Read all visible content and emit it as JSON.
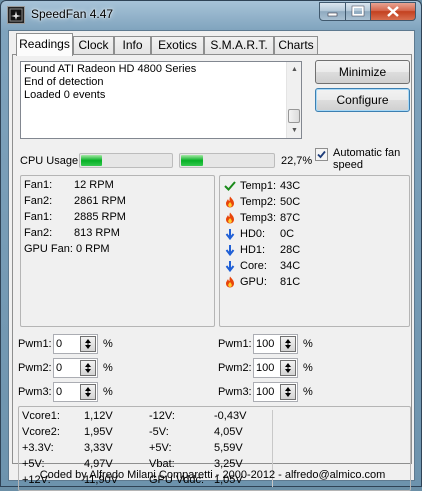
{
  "window": {
    "title": "SpeedFan 4.47",
    "controls": {
      "minimize": "minimize-glyph",
      "maximize": "maximize-glyph",
      "close": "close-glyph"
    }
  },
  "tabs": [
    {
      "label": "Readings",
      "active": true
    },
    {
      "label": "Clock"
    },
    {
      "label": "Info"
    },
    {
      "label": "Exotics"
    },
    {
      "label": "S.M.A.R.T."
    },
    {
      "label": "Charts"
    }
  ],
  "log": {
    "lines": [
      "Found ATI Radeon HD 4800 Series",
      "End of detection",
      "Loaded 0 events"
    ]
  },
  "buttons": {
    "minimize": "Minimize",
    "configure": "Configure"
  },
  "auto_fan": {
    "label": "Automatic fan speed",
    "checked": true
  },
  "cpu": {
    "label": "CPU Usage",
    "value": "22,7%",
    "bar1_fraction": 0.23,
    "bar2_fraction": 0.23,
    "bar_color": "#06b025"
  },
  "fans": [
    {
      "name": "Fan1:",
      "value": "12 RPM"
    },
    {
      "name": "Fan2:",
      "value": "2861 RPM"
    },
    {
      "name": "Fan1:",
      "value": "2885 RPM"
    },
    {
      "name": "Fan2:",
      "value": "813 RPM"
    },
    {
      "name": "GPU Fan:",
      "value": "0 RPM"
    }
  ],
  "temps": [
    {
      "icon": "check-icon",
      "name": "Temp1:",
      "value": "43C"
    },
    {
      "icon": "flame-icon",
      "name": "Temp2:",
      "value": "50C"
    },
    {
      "icon": "flame-icon",
      "name": "Temp3:",
      "value": "87C"
    },
    {
      "icon": "down-arrow-icon",
      "name": "HD0:",
      "value": "0C"
    },
    {
      "icon": "down-arrow-icon",
      "name": "HD1:",
      "value": "28C"
    },
    {
      "icon": "down-arrow-icon",
      "name": "Core:",
      "value": "34C"
    },
    {
      "icon": "flame-icon",
      "name": "GPU:",
      "value": "81C"
    }
  ],
  "pwm_left": [
    {
      "label": "Pwm1:",
      "value": "0",
      "unit": "%"
    },
    {
      "label": "Pwm2:",
      "value": "0",
      "unit": "%"
    },
    {
      "label": "Pwm3:",
      "value": "0",
      "unit": "%"
    }
  ],
  "pwm_right": [
    {
      "label": "Pwm1:",
      "value": "100",
      "unit": "%"
    },
    {
      "label": "Pwm2:",
      "value": "100",
      "unit": "%"
    },
    {
      "label": "Pwm3:",
      "value": "100",
      "unit": "%"
    }
  ],
  "voltages_left": [
    {
      "name": "Vcore1:",
      "value": "1,12V"
    },
    {
      "name": "Vcore2:",
      "value": "1,95V"
    },
    {
      "name": "+3.3V:",
      "value": "3,33V"
    },
    {
      "name": "+5V:",
      "value": "4,97V"
    },
    {
      "name": "+12V:",
      "value": "11,90V"
    }
  ],
  "voltages_right": [
    {
      "name": "-12V:",
      "value": "-0,43V"
    },
    {
      "name": "-5V:",
      "value": "4,05V"
    },
    {
      "name": "+5V:",
      "value": "5,59V"
    },
    {
      "name": "Vbat:",
      "value": "3,25V"
    },
    {
      "name": "GPU Vddc:",
      "value": "1,05V"
    }
  ],
  "footer": {
    "credits": "Coded by Alfredo Milani Comparetti - 2000-2012 - alfredo@almico.com"
  }
}
